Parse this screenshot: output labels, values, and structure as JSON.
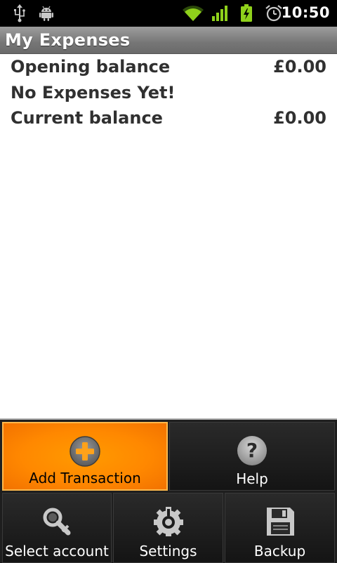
{
  "status_bar": {
    "icons": [
      "usb-icon",
      "android-debug-icon",
      "wifi-icon",
      "signal-icon",
      "battery-charging-icon",
      "alarm-icon"
    ],
    "time": "10:50",
    "accent_color": "#8fd11b"
  },
  "app": {
    "title": "My Expenses"
  },
  "summary": {
    "opening_label": "Opening balance",
    "opening_value": "£0.00",
    "empty_message": "No Expenses Yet!",
    "current_label": "Current balance",
    "current_value": "£0.00"
  },
  "menu": {
    "items": [
      {
        "label": "Add Transaction",
        "icon": "plus-icon",
        "selected": true
      },
      {
        "label": "Help",
        "icon": "help-icon",
        "selected": false
      },
      {
        "label": "Select account",
        "icon": "search-wrench-icon",
        "selected": false
      },
      {
        "label": "Settings",
        "icon": "settings-icon",
        "selected": false
      },
      {
        "label": "Backup",
        "icon": "save-icon",
        "selected": false
      }
    ],
    "selected_color": "#ff8800"
  }
}
